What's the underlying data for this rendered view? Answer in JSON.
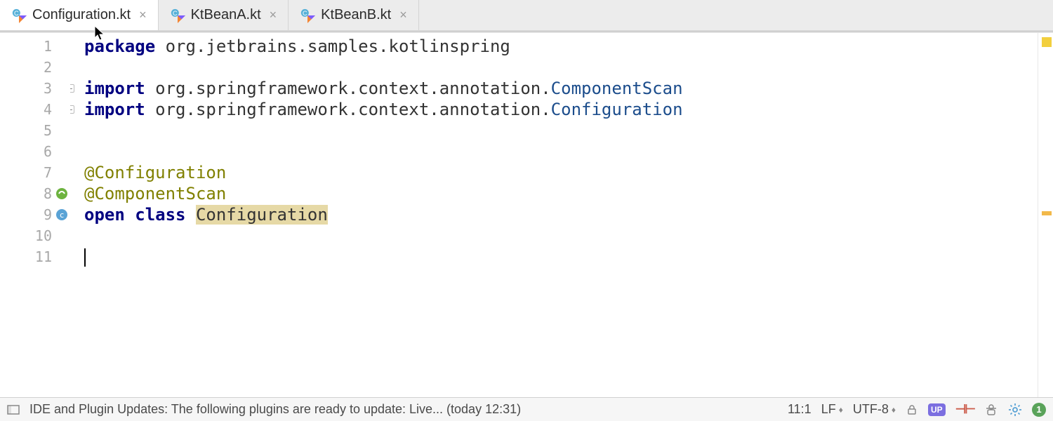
{
  "tabs": [
    {
      "label": "Configuration.kt",
      "active": true
    },
    {
      "label": "KtBeanA.kt",
      "active": false
    },
    {
      "label": "KtBeanB.kt",
      "active": false
    }
  ],
  "code": {
    "line_numbers": [
      "1",
      "2",
      "3",
      "4",
      "5",
      "6",
      "7",
      "8",
      "9",
      "10",
      "11"
    ],
    "package_kw": "package",
    "package_name": " org.jetbrains.samples.kotlinspring",
    "import_kw": "import",
    "import1_pkg": " org.springframework.context.annotation.",
    "import1_cls": "ComponentScan",
    "import2_pkg": " org.springframework.context.annotation.",
    "import2_cls": "Configuration",
    "ann1": "@Configuration",
    "ann2": "@ComponentScan",
    "open_kw": "open",
    "class_kw": "class",
    "classname": "Configuration"
  },
  "status": {
    "msg": "IDE and Plugin Updates: The following plugins are ready to update: Live... (today 12:31)",
    "caret_pos": "11:1",
    "line_sep": "LF",
    "encoding": "UTF-8",
    "notif_count": "1"
  }
}
